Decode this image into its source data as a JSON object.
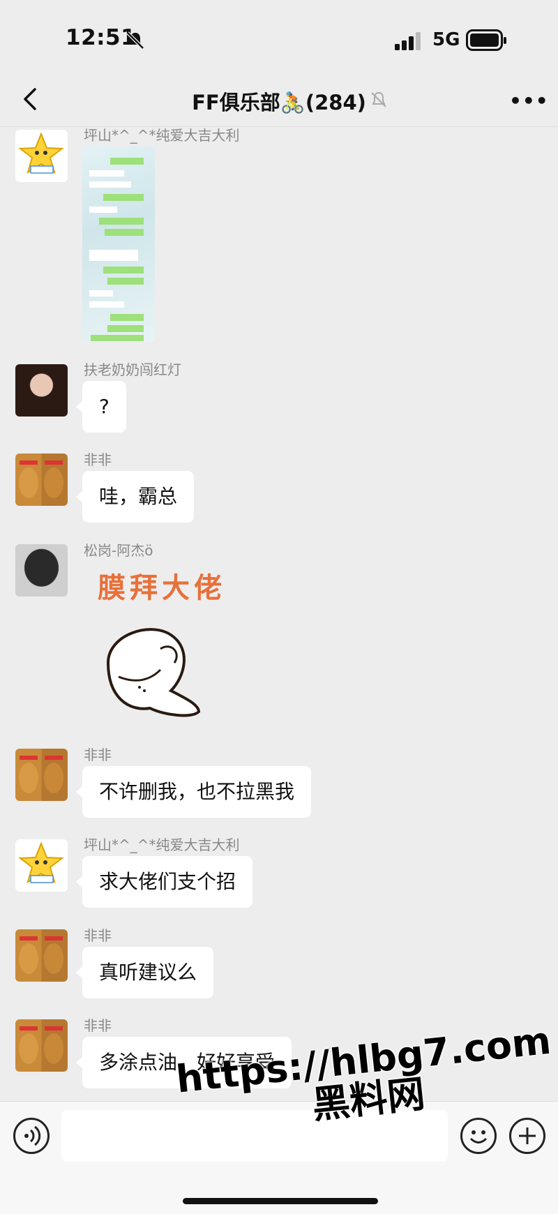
{
  "status_bar": {
    "time": "12:51",
    "network": "5G"
  },
  "header": {
    "title": "FF俱乐部🚴(284)"
  },
  "messages": [
    {
      "sender": "坪山*^_^*纯爱大吉大利",
      "type": "image"
    },
    {
      "sender": "扶老奶奶闯红灯",
      "text": "?"
    },
    {
      "sender": "非非",
      "text": "哇，霸总"
    },
    {
      "sender": "松岗-阿杰ö",
      "type": "sticker",
      "sticker_text": "膜拜大佬"
    },
    {
      "sender": "非非",
      "text": "不许删我，也不拉黑我"
    },
    {
      "sender": "坪山*^_^*纯爱大吉大利",
      "text": "求大佬们支个招"
    },
    {
      "sender": "非非",
      "text": "真听建议么"
    },
    {
      "sender": "非非",
      "text": "多涂点油，好好享受"
    }
  ],
  "input": {
    "value": "",
    "placeholder": ""
  },
  "watermark": {
    "line1": "https://hlbg7.com",
    "line2": "黑料网"
  },
  "icons": [
    "back-icon",
    "mute-icon",
    "more-icon",
    "voice-icon",
    "emoji-icon",
    "plus-icon"
  ]
}
